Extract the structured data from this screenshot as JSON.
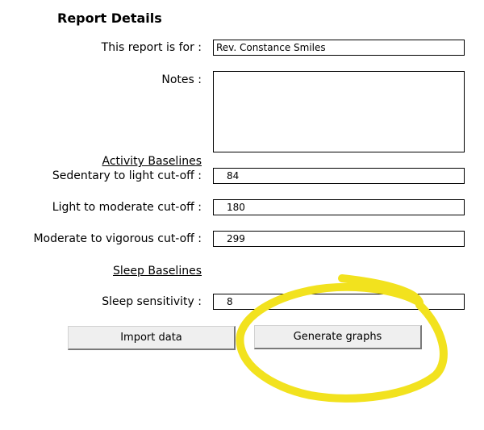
{
  "header": {
    "title": "Report Details"
  },
  "form": {
    "report_for_label": "This report is for :",
    "report_for_value": "Rev. Constance Smiles",
    "notes_label": "Notes :",
    "notes_value": "",
    "activity_section": "Activity Baselines",
    "sedentary_label": "Sedentary to light cut-off :",
    "sedentary_value": "84",
    "light_label": "Light to moderate cut-off :",
    "light_value": "180",
    "moderate_label": "Moderate to vigorous cut-off :",
    "moderate_value": "299",
    "sleep_section": "Sleep Baselines",
    "sleep_label": "Sleep sensitivity :",
    "sleep_value": "8"
  },
  "buttons": {
    "import_label": "Import data",
    "generate_label": "Generate graphs"
  },
  "colors": {
    "annotation": "#f2e21e",
    "field_border": "#000000",
    "button_face": "#efefef"
  }
}
